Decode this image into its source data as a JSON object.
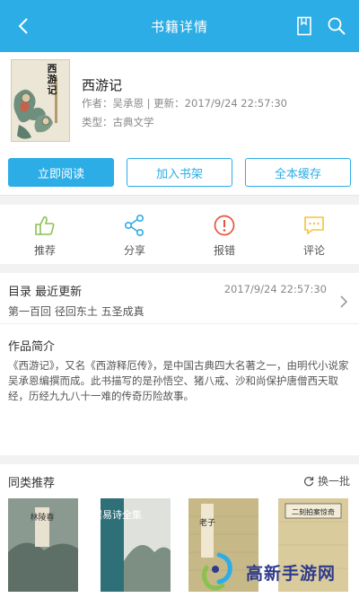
{
  "header": {
    "title": "书籍详情"
  },
  "book": {
    "title": "西游记",
    "cover_title": "西游记",
    "meta_line1": "作者：吴承恩  |  更新：2017/9/24 22:57:30",
    "meta_line2": "类型：古典文学"
  },
  "buttons": {
    "read": "立即阅读",
    "add_shelf": "加入书架",
    "cache_all": "全本缓存"
  },
  "actions": [
    {
      "label": "推荐",
      "color": "#8cc152"
    },
    {
      "label": "分享",
      "color": "#2dade6"
    },
    {
      "label": "报错",
      "color": "#e5533d"
    },
    {
      "label": "评论",
      "color": "#f5c33b"
    }
  ],
  "catalog": {
    "label": "目录  最近更新",
    "time": "2017/9/24 22:57:30",
    "latest_chapter": "第一百回 径回东土 五圣成真"
  },
  "intro": {
    "heading": "作品简介",
    "text": "《西游记》，又名《西游释厄传》，是中国古典四大名著之一，由明代小说家吴承恩编撰而成。此书描写的是孙悟空、猪八戒、沙和尚保护唐僧西天取经，历经九九八十一难的传奇历险故事。"
  },
  "similar": {
    "heading": "同类推荐",
    "refresh_label": "换一批",
    "covers": [
      {
        "title": "林陵春"
      },
      {
        "title": "白居易诗全集"
      },
      {
        "title": "老子"
      },
      {
        "title": "二刻拍案惊奇"
      }
    ]
  },
  "watermark": {
    "text": "高新手游网"
  },
  "colors": {
    "accent": "#2dade6",
    "background": "#f2f2f2"
  }
}
